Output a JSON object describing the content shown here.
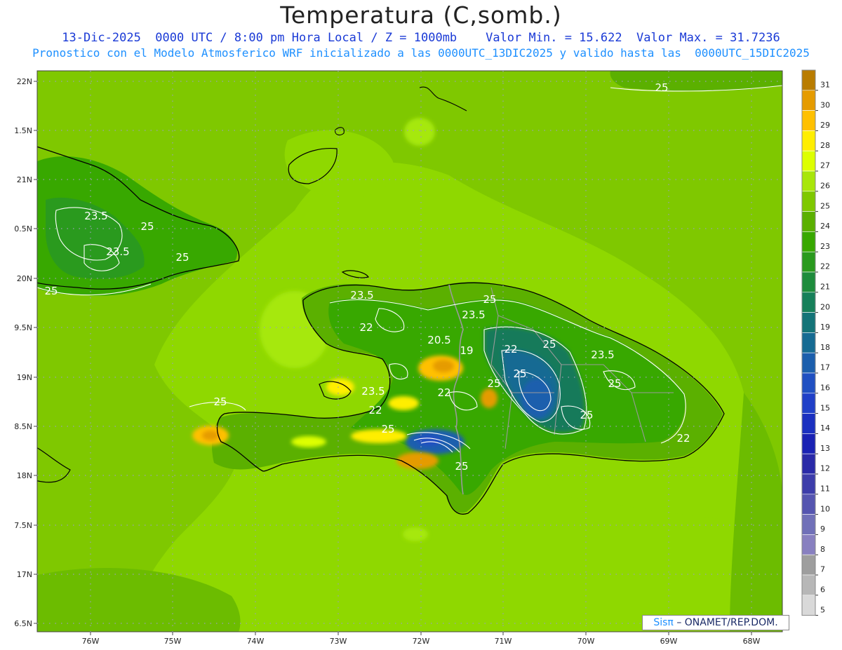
{
  "header": {
    "title": "Temperatura (C,somb.)",
    "line1": "13-Dic-2025  0000 UTC / 8:00 pm Hora Local / Z = 1000mb    Valor Min. = 15.622  Valor Max. = 31.7236",
    "line2": "Pronostico con el Modelo Atmosferico WRF inicializado a las 0000UTC_13DIC2025 y valido hasta las  0000UTC_15DIC2025"
  },
  "axes": {
    "lon_labels": [
      "76W",
      "75W",
      "74W",
      "73W",
      "72W",
      "71W",
      "70W",
      "69W",
      "68W"
    ],
    "lat_labels": [
      "22N",
      "1.5N",
      "21N",
      "0.5N",
      "20N",
      "9.5N",
      "19N",
      "8.5N",
      "18N",
      "7.5N",
      "17N",
      "6.5N"
    ]
  },
  "colorbar": {
    "levels": [
      "31",
      "30",
      "29",
      "28",
      "27",
      "26",
      "25",
      "24",
      "23",
      "22",
      "21",
      "20",
      "19",
      "18",
      "17",
      "16",
      "15",
      "14",
      "13",
      "12",
      "11",
      "10",
      "9",
      "8",
      "7",
      "6",
      "5"
    ],
    "colors": [
      "#b97c00",
      "#e59b00",
      "#ffc000",
      "#ffee00",
      "#ddff00",
      "#a8e60a",
      "#7fc800",
      "#5bb000",
      "#38a800",
      "#2a9a1e",
      "#1e8c3c",
      "#17805a",
      "#147478",
      "#166b93",
      "#1c5fad",
      "#2050c2",
      "#2040c8",
      "#1b30c0",
      "#1a22b4",
      "#2a2aa8",
      "#3d3daa",
      "#5555b0",
      "#7070b8",
      "#8880c0",
      "#9e9e9e",
      "#b7b7b7",
      "#d9d9d9"
    ]
  },
  "contours": {
    "labels": [
      "25",
      "23.5",
      "25",
      "23.5",
      "25",
      "25",
      "23.5",
      "25",
      "23.5",
      "22",
      "20.5",
      "19",
      "22",
      "25",
      "23.5",
      "25",
      "25",
      "25",
      "22",
      "23.5",
      "22",
      "25",
      "25",
      "25",
      "22",
      "25"
    ]
  },
  "credit": {
    "brand": "Sisπ",
    "text": "– ONAMET/REP.DOM."
  }
}
